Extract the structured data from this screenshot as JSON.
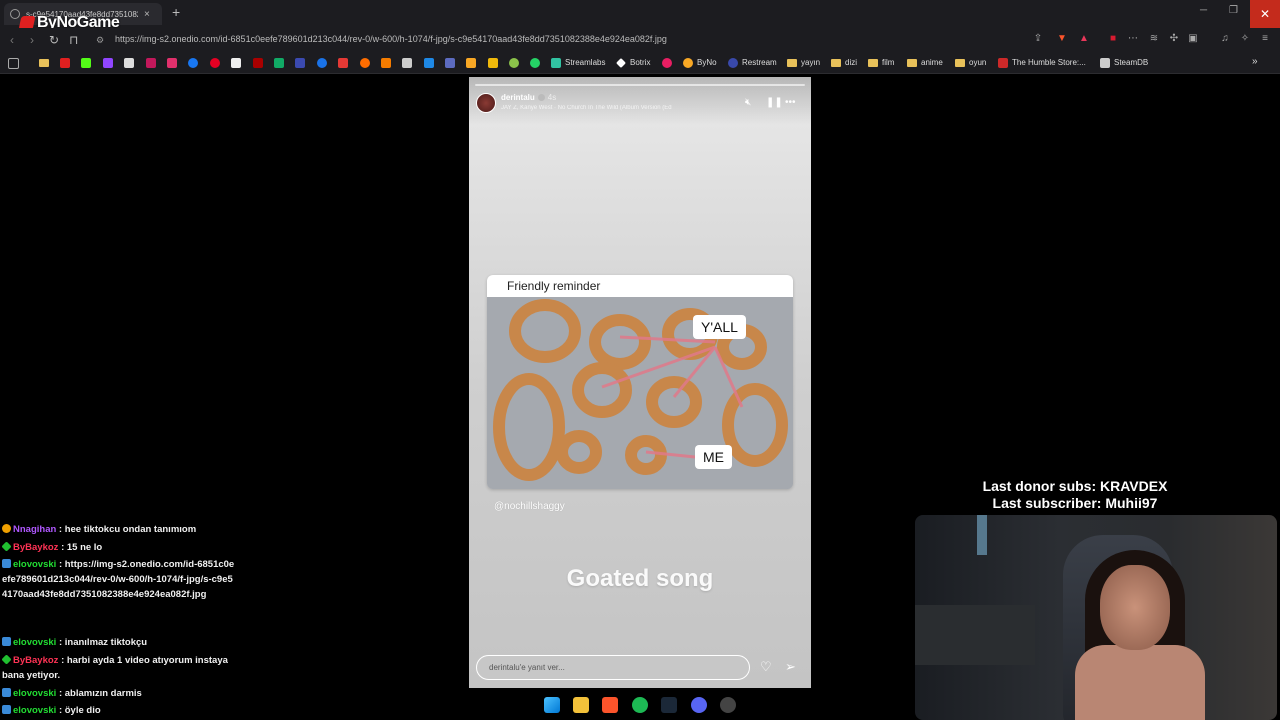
{
  "browser": {
    "tab_title": "s-c9e54170aad43fe8dd7351082",
    "url": "https://img-s2.onedio.com/id-6851c0eefe789601d213c044/rev-0/w-600/h-1074/f-jpg/s-c9e54170aad43fe8dd7351082388e4e924ea082f.jpg",
    "logo_text": "ByNoGame",
    "bookmarks": [
      "Streamlabs",
      "Botrix",
      "ByNo",
      "Restream",
      "yayın",
      "dizi",
      "film",
      "anime",
      "oyun",
      "The Humble Store:...",
      "SteamDB"
    ]
  },
  "story": {
    "username": "derintalu",
    "time": "4s",
    "music": "JAY Z, Kanye West · No Church In The Wild (Album Version (Ed",
    "card_title": "Friendly reminder",
    "label_yall": "Y'ALL",
    "label_me": "ME",
    "handle": "@nochillshaggy",
    "caption": "Goated song",
    "reply_placeholder": "derintalu'e yanıt ver..."
  },
  "chat": [
    {
      "user": "Nnagihan",
      "text": ": hee tiktokcu ondan tanımıom"
    },
    {
      "user": "ByBaykoz",
      "text": ": 15 ne lo"
    },
    {
      "user": "elovovski",
      "text": ": https://img-s2.onedio.com/id-6851c0eefe789601d213c044/rev-0/w-600/h-1074/f-jpg/s-c9e54170aad43fe8dd7351082388e4e924ea082f.jpg"
    },
    {
      "user": "elovovski",
      "text": ": inanılmaz tiktokçu"
    },
    {
      "user": "ByBaykoz",
      "text": ": harbi ayda 1 video atıyorum instaya bana yetiyor."
    },
    {
      "user": "elovovski",
      "text": ": ablamızın darmis"
    },
    {
      "user": "elovovski",
      "text": ": öyle dio"
    }
  ],
  "overlay": {
    "last_donor": "Last donor subs: KRAVDEX",
    "last_subscriber": "Last subscriber: Muhii97"
  }
}
